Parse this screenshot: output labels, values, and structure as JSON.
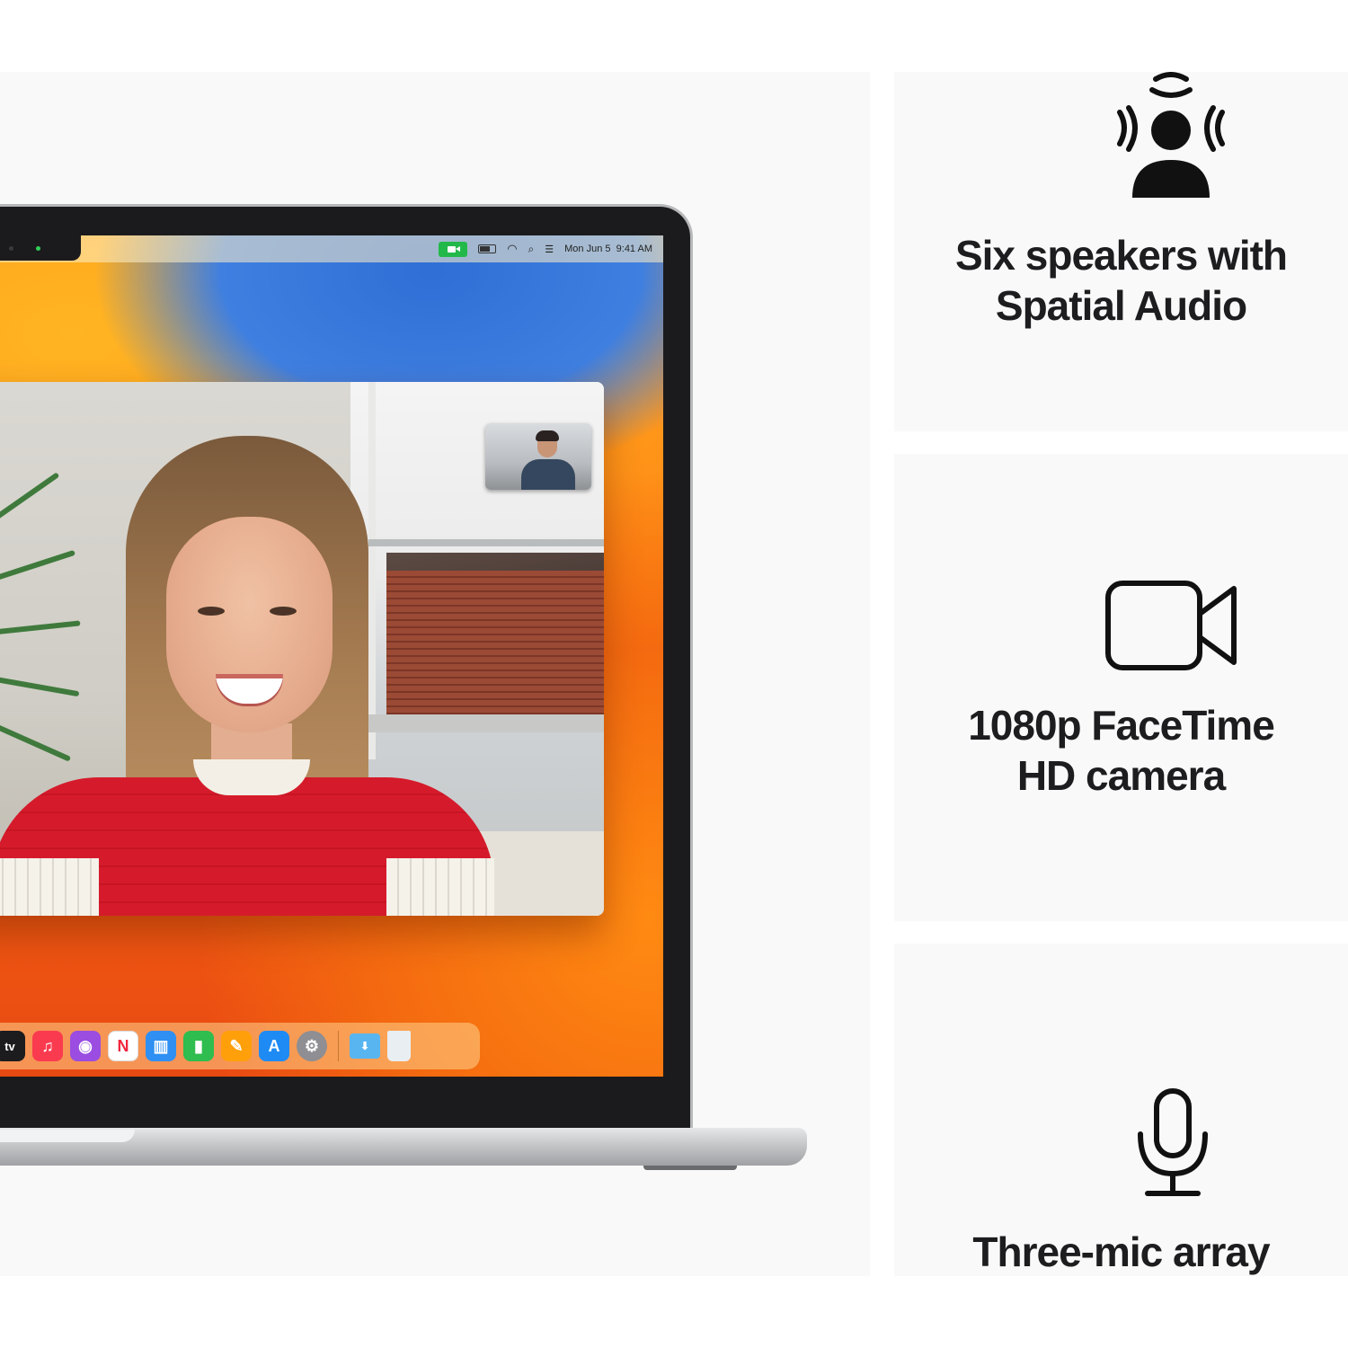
{
  "menubar": {
    "date": "Mon Jun 5",
    "time": "9:41 AM"
  },
  "dock": {
    "apps": [
      {
        "name": "Apple TV",
        "label": "tv",
        "color": "#1c1c1e"
      },
      {
        "name": "Music",
        "label": "♫",
        "color": "#fa3b4f"
      },
      {
        "name": "Podcasts",
        "label": "◉",
        "color": "#9a4de0"
      },
      {
        "name": "News",
        "label": "N",
        "color": "#ffffff"
      },
      {
        "name": "Keynote",
        "label": "▥",
        "color": "#2f8ff2"
      },
      {
        "name": "Numbers",
        "label": "▮",
        "color": "#2ebd4e"
      },
      {
        "name": "Pages",
        "label": "✎",
        "color": "#ff9f0a"
      },
      {
        "name": "App Store",
        "label": "A",
        "color": "#1e8bf5"
      },
      {
        "name": "System Settings",
        "label": "⚙",
        "color": "#8e8e93"
      }
    ],
    "folders": [
      {
        "name": "Downloads",
        "color": "#58b5f0"
      },
      {
        "name": "Trash",
        "color": "#e9eef2"
      }
    ]
  },
  "features": [
    {
      "icon": "spatial-audio-icon",
      "title_line1": "Six speakers with",
      "title_line2": "Spatial Audio"
    },
    {
      "icon": "video-camera-icon",
      "title_line1": "1080p FaceTime",
      "title_line2": "HD camera"
    },
    {
      "icon": "microphone-icon",
      "title_line1": "Three-mic array",
      "title_line2": ""
    }
  ]
}
